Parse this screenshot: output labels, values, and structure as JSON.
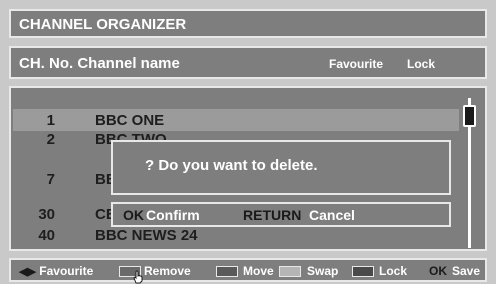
{
  "title": "CHANNEL ORGANIZER",
  "header": {
    "col_channel": "CH. No. Channel name",
    "col_favourite": "Favourite",
    "col_lock": "Lock"
  },
  "channels": [
    {
      "number": "1",
      "name": "BBC ONE",
      "selected": true
    },
    {
      "number": "2",
      "name": "BBC TWO",
      "selected": false
    },
    {
      "number": "7",
      "name": "BBC THREE",
      "selected": false
    },
    {
      "number": "30",
      "name": "CBBC",
      "selected": false
    },
    {
      "number": "40",
      "name": "BBC NEWS 24",
      "selected": false
    }
  ],
  "dialog": {
    "message": "? Do you want to delete.",
    "ok_key": "OK",
    "ok_label": "Confirm",
    "return_key": "RETURN",
    "return_label": "Cancel"
  },
  "footer": {
    "favourite_icon": "left-right-arrow-icon",
    "favourite": "Favourite",
    "remove": "Remove",
    "move": "Move",
    "swap": "Swap",
    "lock": "Lock",
    "save_key": "OK",
    "save": "Save"
  },
  "colors": {
    "panel": "#7e7e7e",
    "border": "#e8e8e8",
    "selected_row": "#9b9b9b",
    "swatch_remove": "#6a6a6a",
    "swatch_move": "#5a5a5a",
    "swatch_swap": "#b5b5b5",
    "swatch_lock": "#4a4a4a"
  }
}
